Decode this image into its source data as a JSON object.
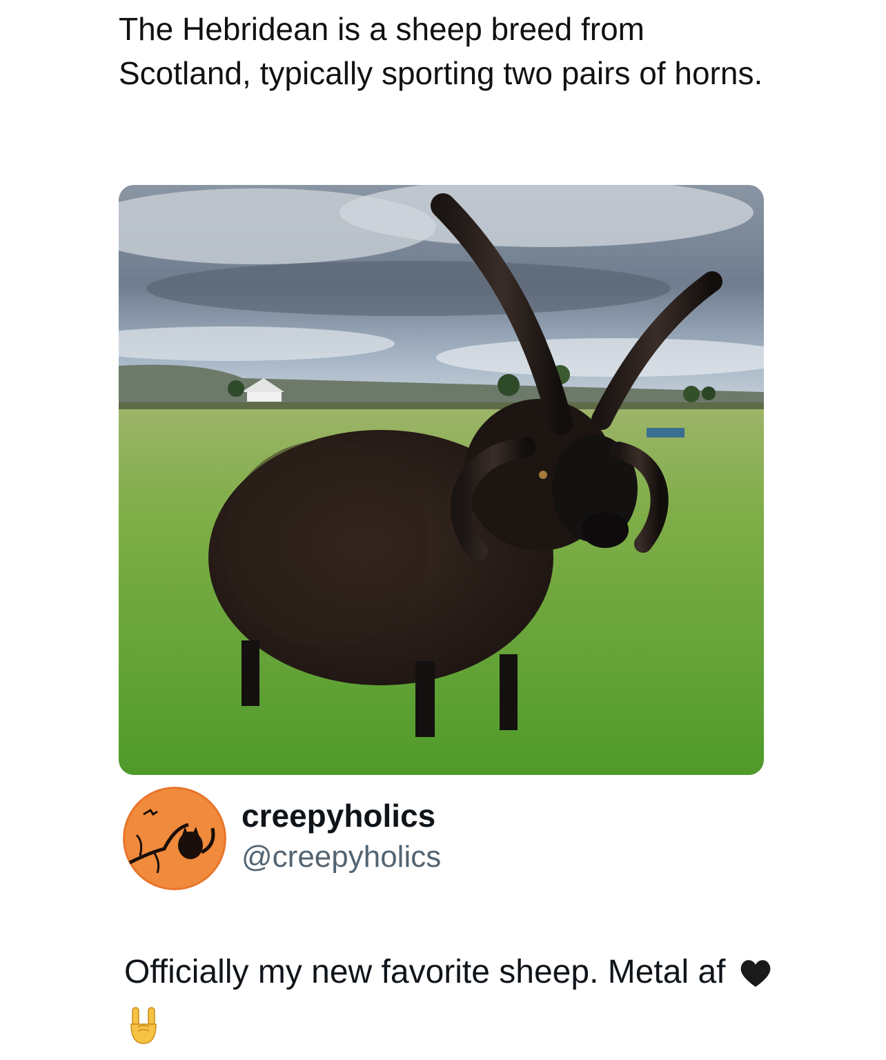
{
  "headline": "The Hebridean is a sheep breed from Scotland, typically sporting two pairs of horns.",
  "photo": {
    "subject": "black four-horned Hebridean sheep standing in a green field under a cloudy sky"
  },
  "author": {
    "display_name": "creepyholics",
    "handle": "@creepyholics",
    "avatar_icon": "orange-moon-cat-avatar"
  },
  "post": {
    "text": "Officially my new favorite sheep. Metal af",
    "emojis": [
      "black-heart-icon",
      "sign-of-the-horns-icon"
    ]
  },
  "colors": {
    "text": "#0f1419",
    "handle": "#536471",
    "avatar": "#e8742a"
  }
}
